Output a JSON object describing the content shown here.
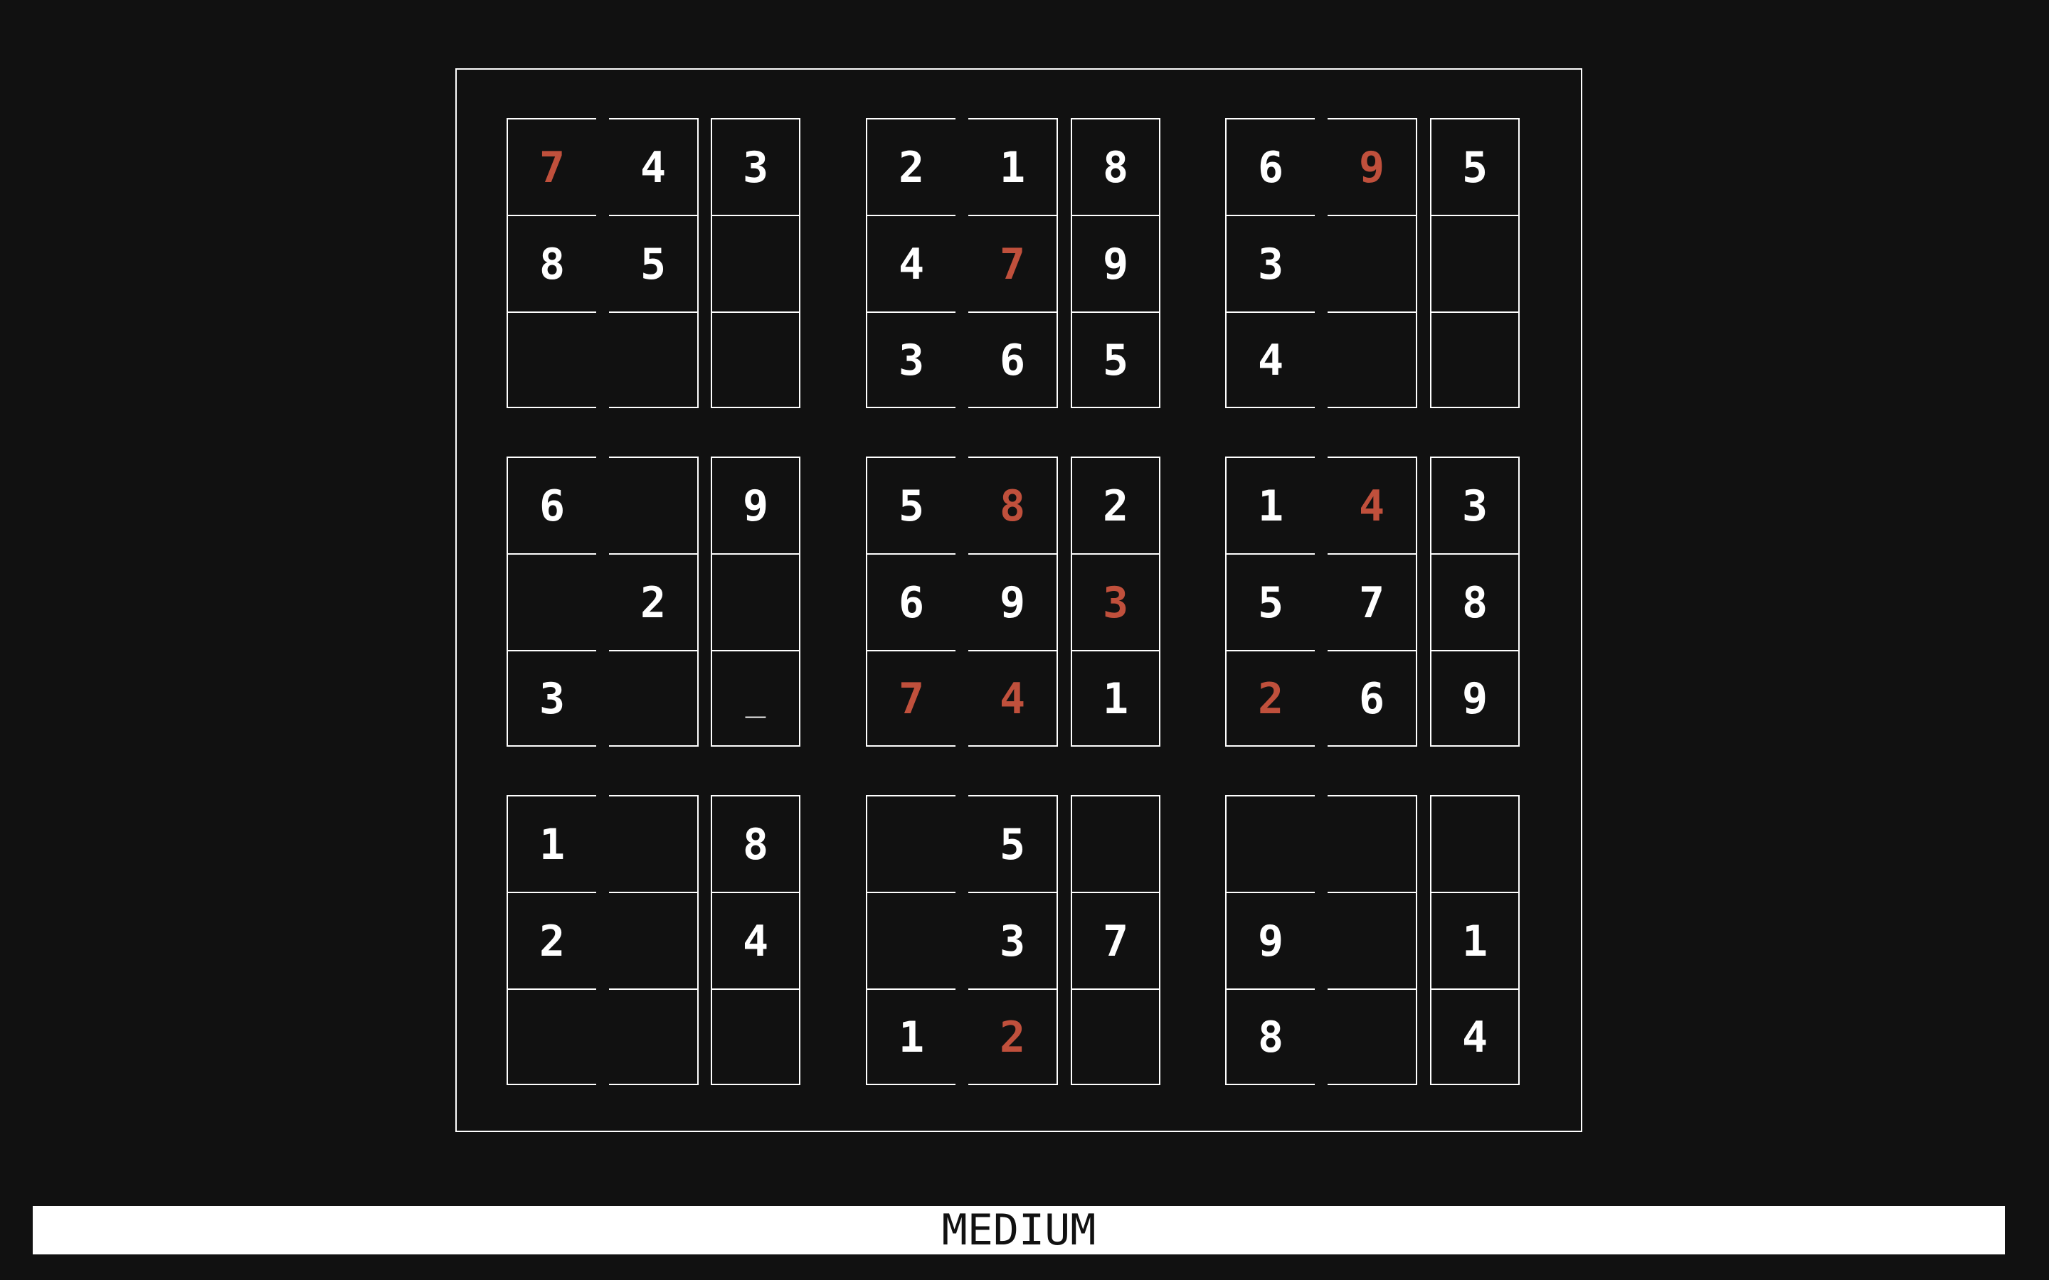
{
  "board": {
    "grid": [
      [
        "7",
        "4",
        "3",
        "2",
        "1",
        "8",
        "6",
        "9",
        "5"
      ],
      [
        "8",
        "5",
        "",
        "4",
        "7",
        "9",
        "3",
        "",
        ""
      ],
      [
        "",
        "",
        "",
        "3",
        "6",
        "5",
        "4",
        "",
        ""
      ],
      [
        "6",
        "",
        "9",
        "5",
        "8",
        "2",
        "1",
        "4",
        "3"
      ],
      [
        "",
        "2",
        "",
        "6",
        "9",
        "3",
        "5",
        "7",
        "8"
      ],
      [
        "3",
        "",
        "_",
        "7",
        "4",
        "1",
        "2",
        "6",
        "9"
      ],
      [
        "1",
        "",
        "8",
        "",
        "5",
        "",
        "",
        "",
        ""
      ],
      [
        "2",
        "",
        "4",
        "",
        "3",
        "7",
        "9",
        "",
        "1"
      ],
      [
        "",
        "",
        "",
        "1",
        "2",
        "",
        "8",
        "",
        "4"
      ]
    ],
    "highlighted_cells": [
      [
        0,
        0
      ],
      [
        0,
        7
      ],
      [
        1,
        4
      ],
      [
        3,
        4
      ],
      [
        3,
        7
      ],
      [
        4,
        5
      ],
      [
        5,
        3
      ],
      [
        5,
        4
      ],
      [
        5,
        6
      ],
      [
        8,
        4
      ]
    ],
    "cursor_cell": [
      5,
      2
    ],
    "colors": {
      "background": "#111111",
      "given": "#ffffff",
      "highlight": "#c0503c"
    }
  },
  "status": {
    "difficulty": "MEDIUM"
  }
}
